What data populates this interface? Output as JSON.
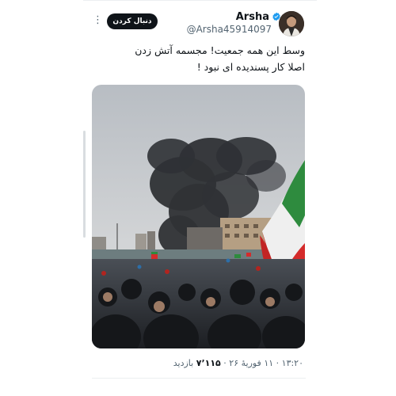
{
  "profile": {
    "display_name": "Arsha",
    "handle": "@Arsha45914097",
    "follow_label": "دنبال کردن"
  },
  "tweet": {
    "line1": "وسط این همه جمعیت! مجسمه آتش زدن",
    "line2": "اصلا کار پسندیده ای نبود !"
  },
  "meta": {
    "views_label": "بازدید",
    "views_count": "۷٬۱۱۵",
    "datetime": "۱۳:۲۰ · ۱۱ فوریهٔ ۲۶"
  }
}
